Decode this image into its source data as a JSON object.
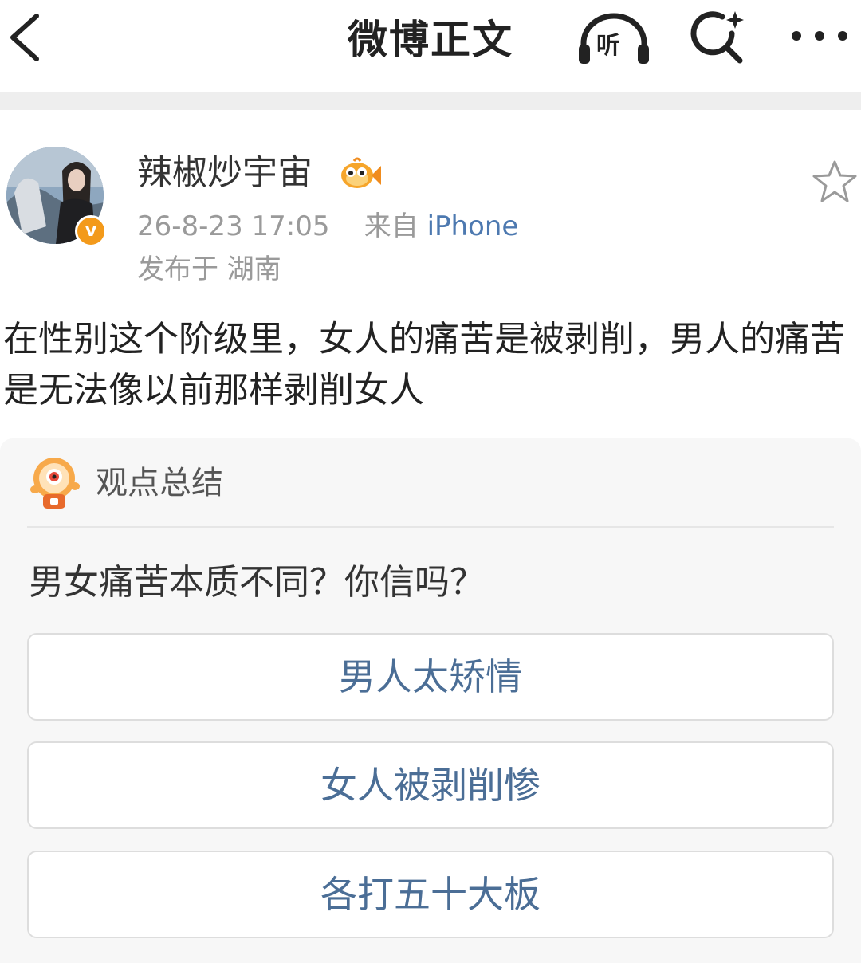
{
  "nav": {
    "title": "微博正文",
    "listen_label": "听"
  },
  "post": {
    "username": "辣椒炒宇宙",
    "timestamp": "26-8-23 17:05",
    "source_prefix": "来自",
    "source": "iPhone",
    "location": "发布于 湖南",
    "text": "在性别这个阶级里，女人的痛苦是被剥削，男人的痛苦是无法像以前那样剥削女人",
    "verified_badge": "v"
  },
  "summary": {
    "label": "观点总结",
    "question": "男女痛苦本质不同？你信吗？",
    "options": [
      "男人太矫情",
      "女人被剥削惨",
      "各打五十大板"
    ]
  },
  "colors": {
    "accent_link": "#4d79b0",
    "option_text": "#4b6e96",
    "badge_orange": "#f39a1b"
  },
  "icons": [
    "back-icon",
    "headphones-icon",
    "search-icon",
    "more-icon",
    "star-icon",
    "fish-emoji-icon",
    "bot-mascot-icon"
  ]
}
